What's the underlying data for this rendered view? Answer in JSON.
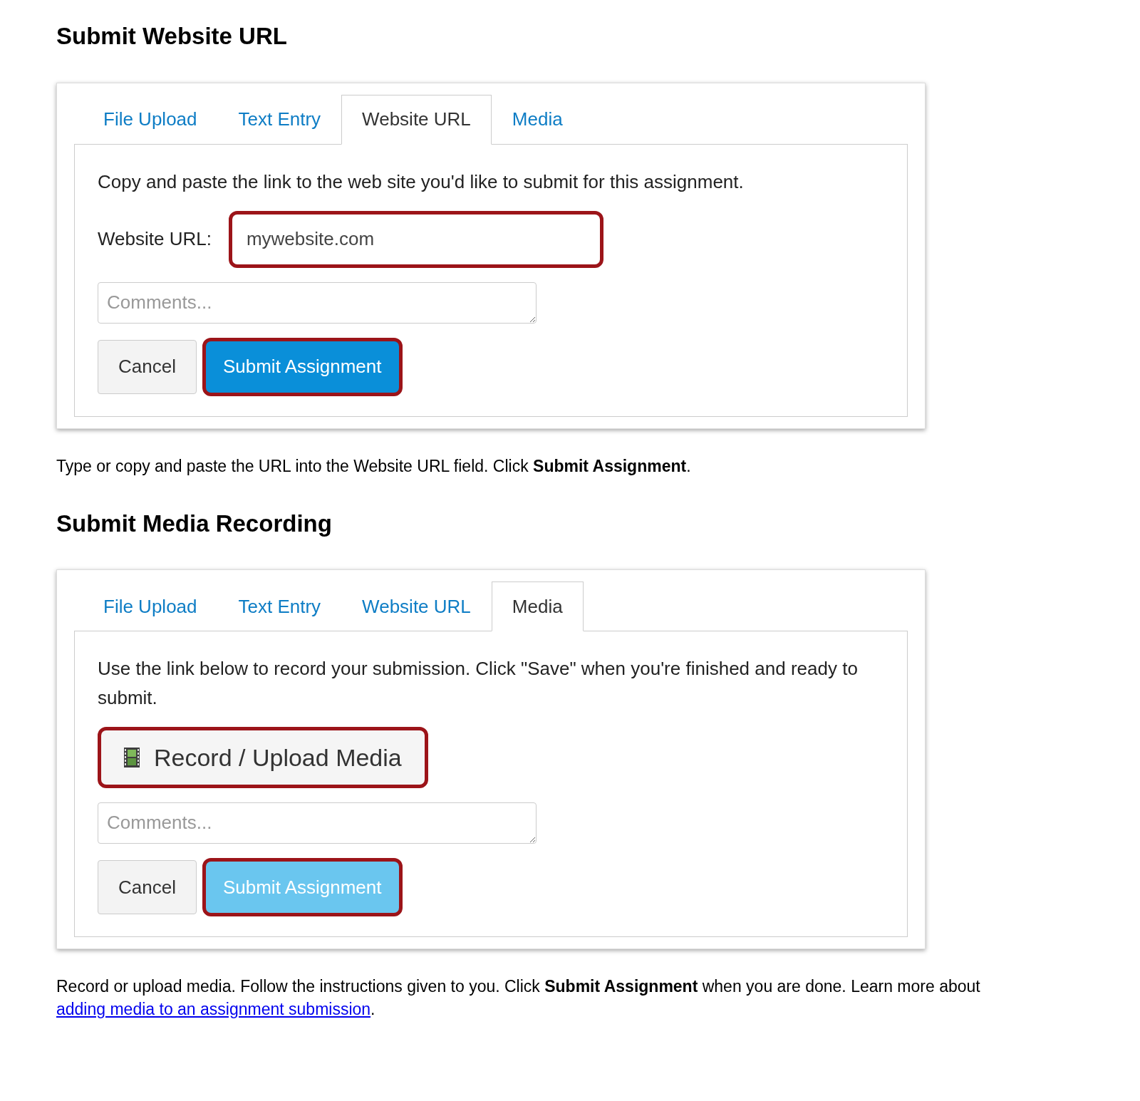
{
  "sections": [
    {
      "heading": "Submit Website URL",
      "panel": {
        "tabs": [
          {
            "label": "File Upload",
            "selected": false
          },
          {
            "label": "Text Entry",
            "selected": false
          },
          {
            "label": "Website URL",
            "selected": true
          },
          {
            "label": "Media",
            "selected": false
          }
        ],
        "instruction": "Copy and paste the link to the web site you'd like to submit for this assignment.",
        "control": {
          "kind": "url",
          "label": "Website URL:",
          "value": "mywebsite.com",
          "highlighted": true
        },
        "comments": {
          "placeholder": "Comments..."
        },
        "buttons": [
          {
            "kind": "cancel",
            "label": "Cancel",
            "highlighted": false,
            "disabled": false
          },
          {
            "kind": "submit",
            "label": "Submit Assignment",
            "highlighted": true,
            "disabled": false
          }
        ]
      },
      "caption": {
        "text": "Type or copy and paste the URL into the Website URL field. Click **Submit Assignment**."
      }
    },
    {
      "heading": "Submit Media Recording",
      "panel": {
        "tabs": [
          {
            "label": "File Upload",
            "selected": false
          },
          {
            "label": "Text Entry",
            "selected": false
          },
          {
            "label": "Website URL",
            "selected": false
          },
          {
            "label": "Media",
            "selected": true
          }
        ],
        "instruction": "Use the link below to record your submission. Click \"Save\" when you're finished and ready to submit.",
        "control": {
          "kind": "media",
          "label": "Record / Upload Media",
          "highlighted": true
        },
        "comments": {
          "placeholder": "Comments..."
        },
        "buttons": [
          {
            "kind": "cancel",
            "label": "Cancel",
            "highlighted": false,
            "disabled": false
          },
          {
            "kind": "submit",
            "label": "Submit Assignment",
            "highlighted": true,
            "disabled": true
          }
        ]
      },
      "caption": {
        "text": "Record or upload media. Follow the instructions given to you. Click **Submit Assignment** when you are done. Learn more about",
        "link": "adding media to an assignment submission",
        "after": "."
      }
    }
  ]
}
